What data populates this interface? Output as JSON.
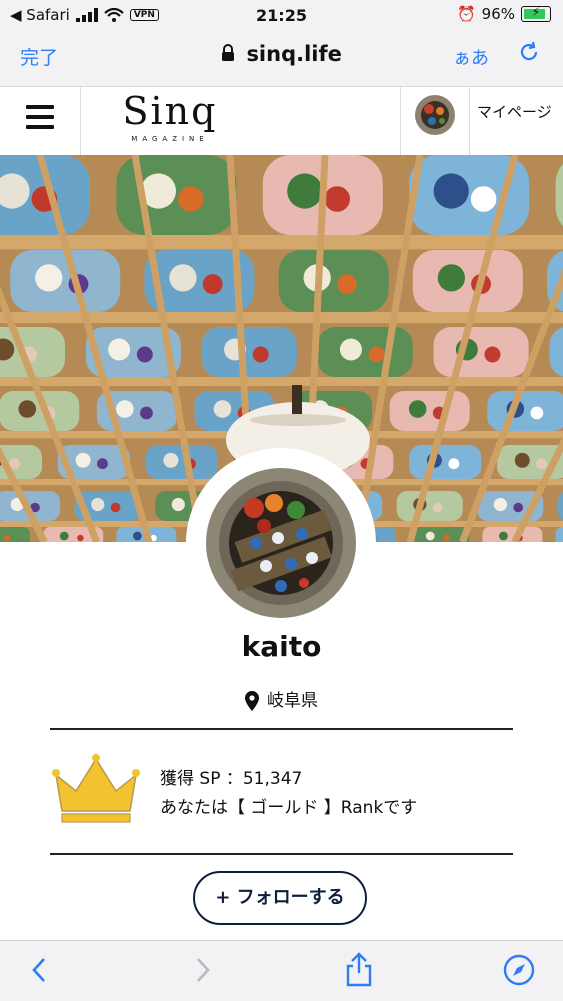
{
  "status_bar": {
    "back_app": "◀ Safari",
    "vpn": "VPN",
    "time": "21:25",
    "battery_percent": "96%",
    "battery_level": 0.96
  },
  "browser": {
    "done_label": "完了",
    "url": "sinq.life",
    "aa_label": "ぁあ"
  },
  "site_header": {
    "logo_text": "Sinq",
    "logo_sub": "MAGAZINE",
    "mypage_label": "マイページ"
  },
  "profile": {
    "username": "kaito",
    "location": "岐阜県",
    "points_line": "獲得 SP ：51,347",
    "rank_line": "あなたは【 ゴールド 】Rankです",
    "follow_label": "+ フォローする"
  },
  "colors": {
    "ios_blue": "#2f7cf6",
    "follow_navy": "#0f1e3c",
    "crown_gold": "#f2c230",
    "wood": "#c79a5f"
  },
  "icons": [
    "hamburger-icon",
    "lock-icon",
    "reload-icon",
    "location-pin-icon",
    "crown-icon",
    "back-icon",
    "forward-icon",
    "share-icon",
    "compass-icon"
  ]
}
